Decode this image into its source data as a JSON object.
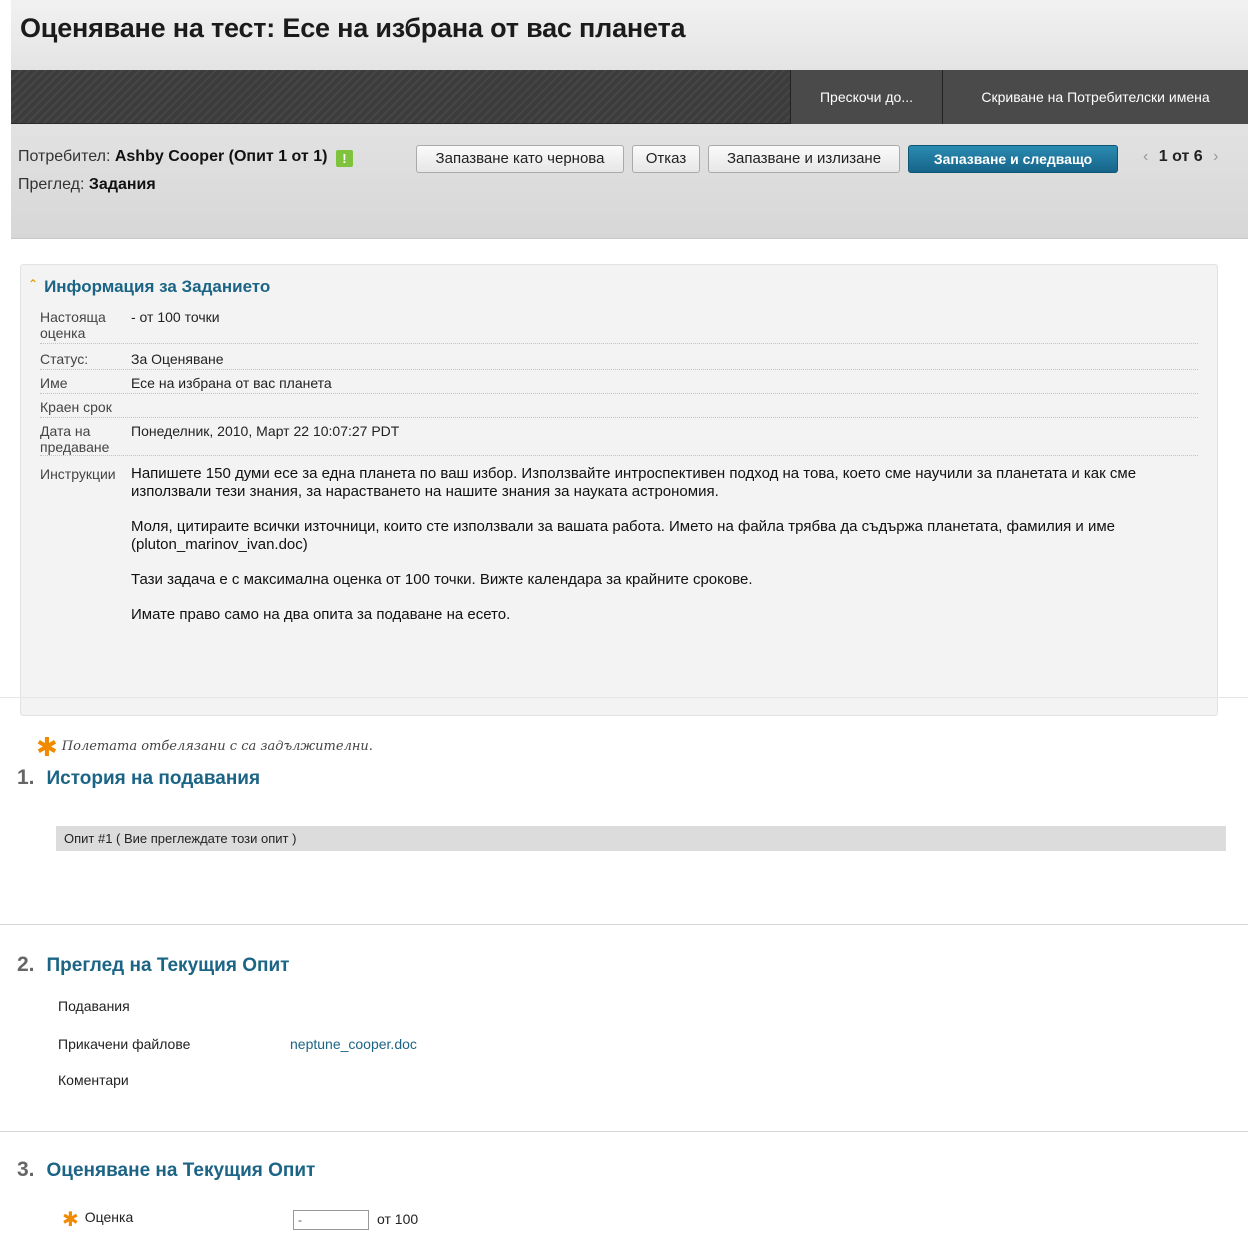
{
  "header": {
    "title": "Оценяване на тест: Есе на избрана от вас планета"
  },
  "nav": {
    "jump_label": "Прескочи до...",
    "hide_label": "Скриване на Потребителски имена"
  },
  "action_bar": {
    "user_label": "Потребител:",
    "user_value": "Ashby Cooper (Опит 1 от 1)",
    "flag_glyph": "!",
    "view_label": "Преглед:",
    "view_value": "Задания",
    "buttons": {
      "save_draft": "Запазване като чернова",
      "cancel": "Отказ",
      "save_exit": "Запазване и излизане",
      "save_next": "Запазване и следващо"
    },
    "pager": {
      "current": "1 от 6"
    }
  },
  "info_panel": {
    "title": "Информация за Заданието",
    "rows": [
      {
        "label": "Настояща оценка",
        "value": "- от 100 точки"
      },
      {
        "label": "Статус:",
        "value": "За Оценяване"
      },
      {
        "label": "Име",
        "value": "Есе на избрана от вас планета"
      },
      {
        "label": "Краен срок",
        "value": ""
      },
      {
        "label": "Дата на предаване",
        "value": "Понеделник, 2010, Март 22 10:07:27 PDT"
      }
    ],
    "instructions_label": "Инструкции",
    "instructions": [
      "Напишете 150 думи есе за една планета по ваш избор. Използвайте интроспективен подход на това, което сме научили за планетата и как сме използвали тези знания, за нарастването на нашите знания за науката астрономия.",
      "Моля, цитираите всички източници, които сте използвали за вашата работа. Името на файла трябва да съдържа планетата, фамилия и име (pluton_marinov_ivan.doc)",
      "Тази задача е с максимална оценка от 100 точки. Вижте календара за крайните срокове.",
      "Имате право само на два опита за подаване на есето."
    ]
  },
  "required_note": "Полетата отбелязани с са задължителни.",
  "sections": [
    {
      "num": "1.",
      "title": "История на подавания"
    },
    {
      "num": "2.",
      "title": "Преглед на Текущия Опит"
    },
    {
      "num": "3.",
      "title": "Оценяване на Текущия Опит"
    }
  ],
  "history": {
    "attempt_text": "Опит #1 ( Вие преглеждате този опит )"
  },
  "current_attempt": {
    "submissions_label": "Подавания",
    "attachments_label": "Прикачени файлове",
    "attachment_file": "neptune_cooper.doc",
    "comments_label": "Коментари"
  },
  "grading": {
    "grade_label": "Оценка",
    "grade_value": "-",
    "max_text": "от 100"
  },
  "colors": {
    "accent": "#1b6485",
    "primary_button": "#17648a",
    "required": "#f08a00"
  }
}
